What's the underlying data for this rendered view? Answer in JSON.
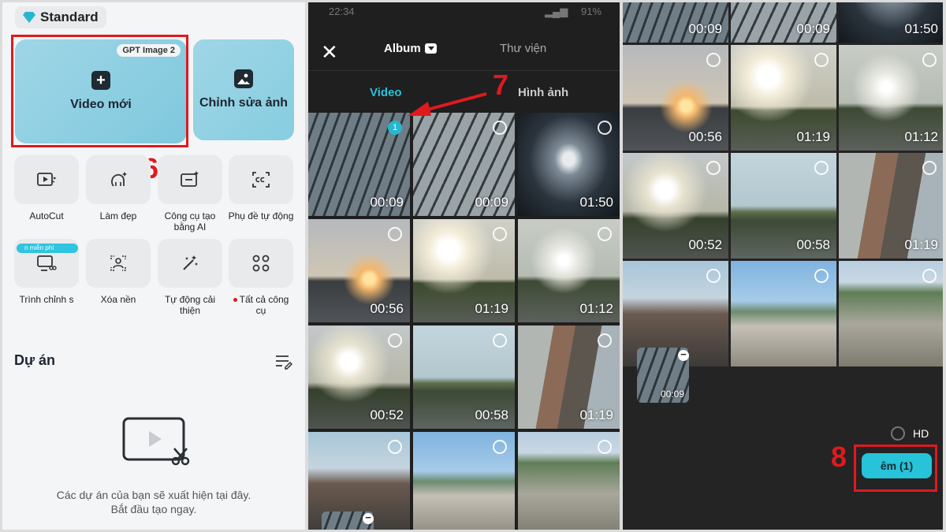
{
  "panel1": {
    "plan": "Standard",
    "gpt_badge": "GPT Image 2",
    "new_video": "Video mới",
    "edit_photo": "Chỉnh sửa ảnh",
    "step": "6",
    "tools": [
      {
        "label": "AutoCut"
      },
      {
        "label": "Làm đẹp"
      },
      {
        "label": "Công cụ tạo bằng AI"
      },
      {
        "label": "Phụ đề tự động"
      },
      {
        "label": "Trình chỉnh s",
        "tag": "n miễn phí"
      },
      {
        "label": "Xóa nền"
      },
      {
        "label": "Tự động cải thiện"
      },
      {
        "label": "Tất cả công cụ"
      }
    ],
    "projects_title": "Dự án",
    "empty_text": "Các dự án của bạn sẽ xuất hiện tại đây.",
    "empty_cta": "Bắt đầu tạo ngay."
  },
  "panel2": {
    "status_time": "22:34",
    "status_battery": "91%",
    "tab_album": "Album",
    "tab_library": "Thư viện",
    "type_video": "Video",
    "type_image": "Hình ảnh",
    "step": "7",
    "selected_index": "1",
    "durations": [
      "00:09",
      "00:09",
      "01:50",
      "00:56",
      "01:19",
      "01:12",
      "00:52",
      "00:58",
      "01:19"
    ]
  },
  "panel3": {
    "durations": [
      "00:09",
      "00:09",
      "01:50",
      "00:56",
      "01:19",
      "01:12",
      "00:52",
      "00:58",
      "01:19"
    ],
    "selected_duration": "00:09",
    "hd_label": "HD",
    "add_button": "êm (1)",
    "step": "8"
  },
  "colors": {
    "accent": "#26c3d9",
    "highlight": "#e0191e"
  }
}
